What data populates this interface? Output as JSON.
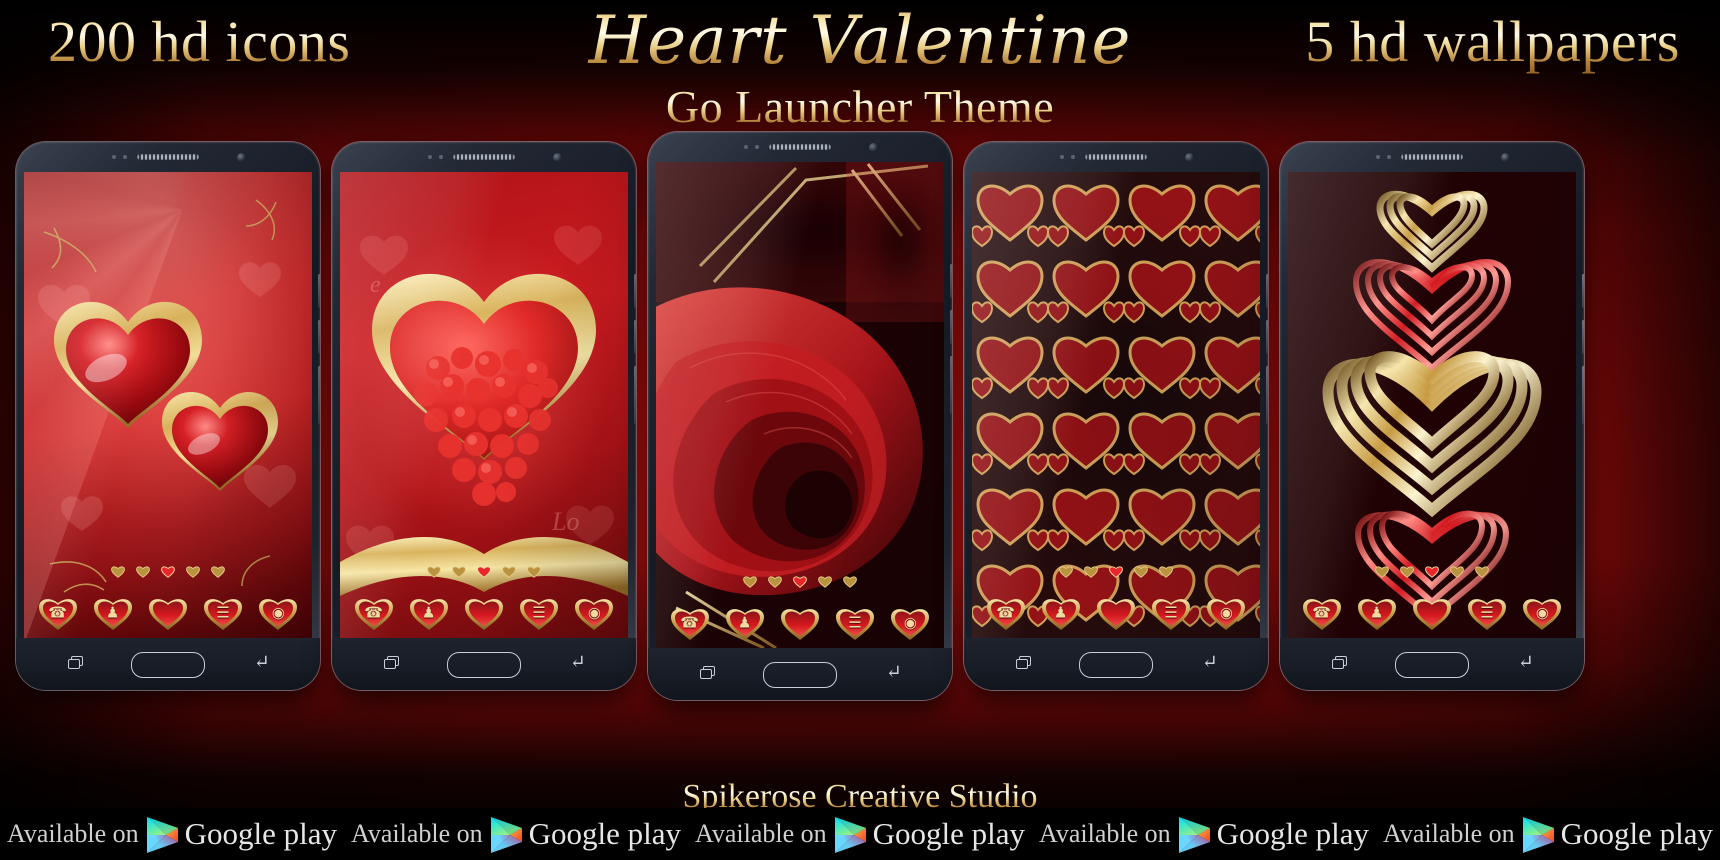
{
  "header": {
    "left_badge": "200 hd icons",
    "title": "Heart Valentine",
    "subtitle": "Go Launcher Theme",
    "right_badge": "5 hd wallpapers"
  },
  "footer": {
    "studio": "Spikerose Creative Studio",
    "play_badges": [
      {
        "available_label": "Available on",
        "store_label": "Google play"
      },
      {
        "available_label": "Available on",
        "store_label": "Google play"
      },
      {
        "available_label": "Available on",
        "store_label": "Google play"
      },
      {
        "available_label": "Available on",
        "store_label": "Google play"
      },
      {
        "available_label": "Available on",
        "store_label": "Google play"
      }
    ]
  },
  "colors": {
    "background_red": "#c81515",
    "background_dark": "#0a0000",
    "gold_light": "#fffbe8",
    "gold_mid": "#e9cf86",
    "gold_dark": "#8d5f23",
    "heart_red": "#c01418",
    "phone_bezel": "#20252f",
    "play_tri_cyan": "#00d2ff",
    "play_tri_green": "#6fe06f",
    "play_tri_orange": "#ff9a2e",
    "play_tri_red": "#f04a3c",
    "play_tri_magenta": "#d6267f"
  },
  "phones": [
    {
      "id": "phone-1",
      "wallpaper_name": "two-glossy-gold-rimmed-hearts",
      "page_indicator": {
        "count": 5,
        "active_index": 2
      },
      "dock": [
        {
          "name": "phone-icon",
          "glyph": "☎"
        },
        {
          "name": "contacts-icon",
          "glyph": "♟"
        },
        {
          "name": "messages-icon",
          "glyph": ""
        },
        {
          "name": "menu-icon",
          "glyph": "☰"
        },
        {
          "name": "camera-icon",
          "glyph": "◉"
        }
      ],
      "navbar": {
        "recents": "recents-icon",
        "home": "home-icon",
        "back": "back-icon"
      }
    },
    {
      "id": "phone-2",
      "wallpaper_name": "heart-cluster-with-gold-ribbon",
      "page_indicator": {
        "count": 5,
        "active_index": 2
      },
      "dock": [
        {
          "name": "phone-icon",
          "glyph": "☎"
        },
        {
          "name": "contacts-icon",
          "glyph": "♟"
        },
        {
          "name": "messages-icon",
          "glyph": ""
        },
        {
          "name": "menu-icon",
          "glyph": "☰"
        },
        {
          "name": "camera-icon",
          "glyph": "◉"
        }
      ],
      "navbar": {
        "recents": "recents-icon",
        "home": "home-icon",
        "back": "back-icon"
      }
    },
    {
      "id": "phone-3",
      "wallpaper_name": "red-rose-closeup",
      "page_indicator": {
        "count": 5,
        "active_index": 2
      },
      "dock": [
        {
          "name": "phone-icon",
          "glyph": "☎"
        },
        {
          "name": "contacts-icon",
          "glyph": "♟"
        },
        {
          "name": "messages-icon",
          "glyph": ""
        },
        {
          "name": "menu-icon",
          "glyph": "☰"
        },
        {
          "name": "camera-icon",
          "glyph": "◉"
        }
      ],
      "navbar": {
        "recents": "recents-icon",
        "home": "home-icon",
        "back": "back-icon"
      }
    },
    {
      "id": "phone-4",
      "wallpaper_name": "tiled-gold-outline-hearts",
      "page_indicator": {
        "count": 5,
        "active_index": 2
      },
      "dock": [
        {
          "name": "phone-icon",
          "glyph": "☎"
        },
        {
          "name": "contacts-icon",
          "glyph": "♟"
        },
        {
          "name": "messages-icon",
          "glyph": ""
        },
        {
          "name": "menu-icon",
          "glyph": "☰"
        },
        {
          "name": "camera-icon",
          "glyph": "◉"
        }
      ],
      "navbar": {
        "recents": "recents-icon",
        "home": "home-icon",
        "back": "back-icon"
      }
    },
    {
      "id": "phone-5",
      "wallpaper_name": "concentric-gold-and-red-ribbon-hearts",
      "page_indicator": {
        "count": 5,
        "active_index": 2
      },
      "dock": [
        {
          "name": "phone-icon",
          "glyph": "☎"
        },
        {
          "name": "contacts-icon",
          "glyph": "♟"
        },
        {
          "name": "messages-icon",
          "glyph": ""
        },
        {
          "name": "menu-icon",
          "glyph": "☰"
        },
        {
          "name": "camera-icon",
          "glyph": "◉"
        }
      ],
      "navbar": {
        "recents": "recents-icon",
        "home": "home-icon",
        "back": "back-icon"
      }
    }
  ]
}
